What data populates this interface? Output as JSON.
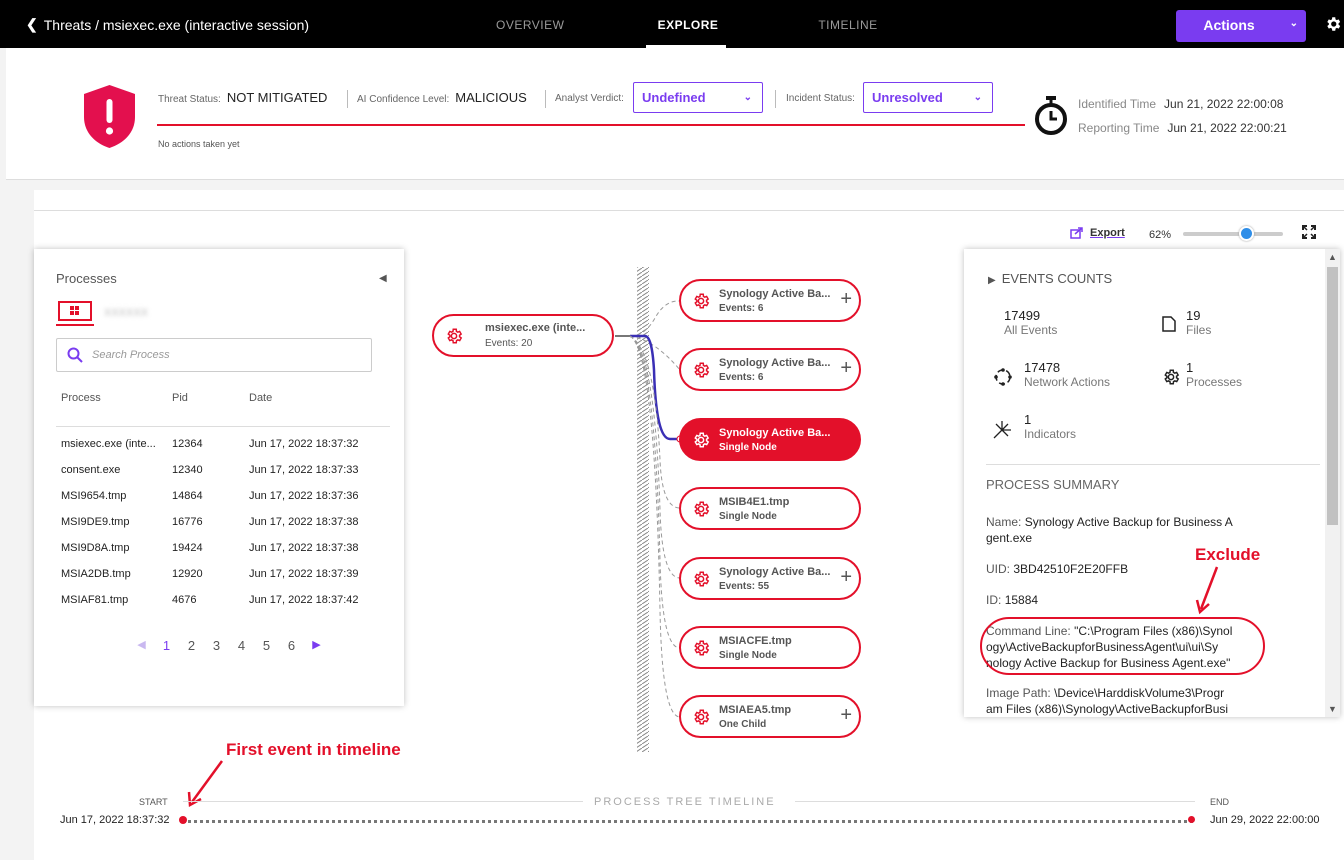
{
  "topbar": {
    "breadcrumb": "Threats / msiexec.exe (interactive session)",
    "tabs": [
      {
        "label": "OVERVIEW",
        "active": false
      },
      {
        "label": "EXPLORE",
        "active": true
      },
      {
        "label": "TIMELINE",
        "active": false
      }
    ],
    "actions_label": "Actions",
    "accent": "#7a3cf0"
  },
  "header": {
    "threat_status_label": "Threat Status:",
    "threat_status_value": "NOT MITIGATED",
    "ai_confidence_label": "AI Confidence Level:",
    "ai_confidence_value": "MALICIOUS",
    "analyst_verdict_label": "Analyst Verdict:",
    "analyst_verdict_value": "Undefined",
    "incident_status_label": "Incident Status:",
    "incident_status_value": "Unresolved",
    "no_actions": "No actions taken yet",
    "identified_time_label": "Identified Time",
    "identified_time_value": "Jun 21, 2022 22:00:08",
    "reporting_time_label": "Reporting Time",
    "reporting_time_value": "Jun 21, 2022 22:00:21",
    "alert_color": "#e3102a"
  },
  "toolbar": {
    "export_label": "Export",
    "zoom_label": "62%",
    "zoom_value": 0.62
  },
  "processes": {
    "title": "Processes",
    "host_name": "XXXXXX",
    "search_placeholder": "Search Process",
    "columns": [
      "Process",
      "Pid",
      "Date"
    ],
    "rows": [
      {
        "process": "msiexec.exe (inte...",
        "pid": "12364",
        "date": "Jun 17, 2022 18:37:32"
      },
      {
        "process": "consent.exe",
        "pid": "12340",
        "date": "Jun 17, 2022 18:37:33"
      },
      {
        "process": "MSI9654.tmp",
        "pid": "14864",
        "date": "Jun 17, 2022 18:37:36"
      },
      {
        "process": "MSI9DE9.tmp",
        "pid": "16776",
        "date": "Jun 17, 2022 18:37:38"
      },
      {
        "process": "MSI9D8A.tmp",
        "pid": "19424",
        "date": "Jun 17, 2022 18:37:38"
      },
      {
        "process": "MSIA2DB.tmp",
        "pid": "12920",
        "date": "Jun 17, 2022 18:37:39"
      },
      {
        "process": "MSIAF81.tmp",
        "pid": "4676",
        "date": "Jun 17, 2022 18:37:42"
      }
    ],
    "pages": [
      "1",
      "2",
      "3",
      "4",
      "5",
      "6"
    ],
    "current_page": "1"
  },
  "tree": {
    "root": {
      "name": "msiexec.exe (inte...",
      "sub": "Events: 20"
    },
    "children": [
      {
        "name": "Synology Active Ba...",
        "sub": "Events: 6",
        "expandable": true,
        "selected": false
      },
      {
        "name": "Synology Active Ba...",
        "sub": "Events: 6",
        "expandable": true,
        "selected": false
      },
      {
        "name": "Synology Active Ba...",
        "sub": "Single Node",
        "expandable": false,
        "selected": true
      },
      {
        "name": "MSIB4E1.tmp",
        "sub": "Single Node",
        "expandable": false,
        "selected": false
      },
      {
        "name": "Synology Active Ba...",
        "sub": "Events: 55",
        "expandable": true,
        "selected": false
      },
      {
        "name": "MSIACFE.tmp",
        "sub": "Single Node",
        "expandable": false,
        "selected": false
      },
      {
        "name": "MSIAEA5.tmp",
        "sub": "One Child",
        "expandable": true,
        "selected": false
      }
    ]
  },
  "events": {
    "title": "EVENTS COUNTS",
    "items": [
      {
        "count": "17499",
        "label": "All Events",
        "icon": "none"
      },
      {
        "count": "19",
        "label": "Files",
        "icon": "file-icon"
      },
      {
        "count": "17478",
        "label": "Network Actions",
        "icon": "network-icon"
      },
      {
        "count": "1",
        "label": "Processes",
        "icon": "gear-icon"
      },
      {
        "count": "1",
        "label": "Indicators",
        "icon": "indicator-icon"
      }
    ],
    "summary_title": "PROCESS SUMMARY",
    "summary": {
      "name_label": "Name:",
      "name_line1": "Synology Active Backup for Business A",
      "name_line2": "gent.exe",
      "uid_label": "UID:",
      "uid_value": "3BD42510F2E20FFB",
      "id_label": "ID:",
      "id_value": "15884",
      "cmd_label": "Command Line:",
      "cmd_line1": "\"C:\\Program Files (x86)\\Synol",
      "cmd_line2": "ogy\\ActiveBackupforBusinessAgent\\ui\\ui\\Sy",
      "cmd_line3": "nology Active Backup for Business Agent.exe\"",
      "image_label": "Image Path:",
      "image_line1": "\\Device\\HarddiskVolume3\\Progr",
      "image_line2": "am Files (x86)\\Synology\\ActiveBackupforBusi"
    }
  },
  "annotations": {
    "exclude": "Exclude",
    "first_event": "First event in timeline"
  },
  "timeline": {
    "title": "PROCESS TREE TIMELINE",
    "start_label": "START",
    "end_label": "END",
    "start_date": "Jun 17, 2022 18:37:32",
    "end_date": "Jun 29, 2022 22:00:00"
  }
}
